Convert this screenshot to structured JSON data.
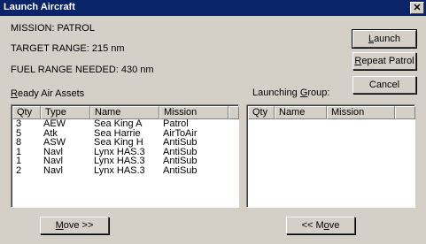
{
  "window": {
    "title": "Launch Aircraft",
    "close_glyph": "✕"
  },
  "mission": {
    "mission_line": "MISSION: PATROL",
    "target_line": "TARGET RANGE:  215 nm",
    "fuel_line": "FUEL RANGE NEEDED:  430 nm"
  },
  "buttons": {
    "launch_first": "L",
    "launch_rest": "aunch",
    "repeat_first": "R",
    "repeat_rest": "epeat Patrol",
    "cancel": "Cancel",
    "move_right_first": "M",
    "move_right_rest": "ove >>",
    "move_left_pre": "<< M",
    "move_left_u": "o",
    "move_left_post": "ve"
  },
  "ready": {
    "label_first": "R",
    "label_rest": "eady Air Assets",
    "columns": [
      "Qty",
      "Type",
      "Name",
      "Mission"
    ],
    "rows": [
      {
        "qty": "3",
        "type": "AEW",
        "name": "Sea King A",
        "mission": "Patrol"
      },
      {
        "qty": "5",
        "type": "Atk",
        "name": "Sea Harrie",
        "mission": "AirToAir"
      },
      {
        "qty": "8",
        "type": "ASW",
        "name": "Sea King H",
        "mission": "AntiSub"
      },
      {
        "qty": "1",
        "type": "Navl",
        "name": "Lynx HAS.3",
        "mission": "AntiSub"
      },
      {
        "qty": "1",
        "type": "Navl",
        "name": "Lynx HAS.3",
        "mission": "AntiSub"
      },
      {
        "qty": "2",
        "type": "Navl",
        "name": "Lynx HAS.3",
        "mission": "AntiSub"
      }
    ]
  },
  "launching": {
    "label_pre": "Launching ",
    "label_u": "G",
    "label_post": "roup:",
    "columns": [
      "Qty",
      "Name",
      "Mission"
    ]
  }
}
